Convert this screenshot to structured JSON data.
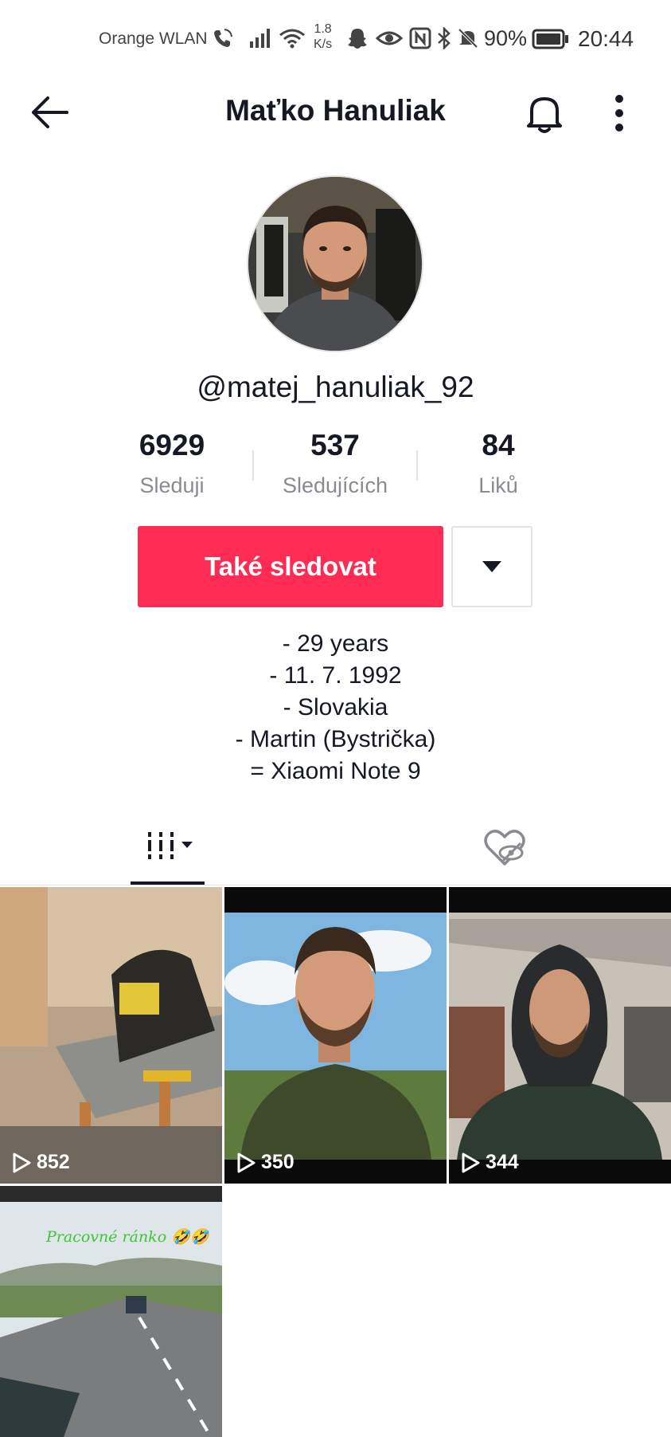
{
  "status_bar": {
    "carrier": "Orange WLAN",
    "net_speed_value": "1.8",
    "net_speed_unit": "K/s",
    "battery": "90%",
    "time": "20:44"
  },
  "header": {
    "title": "Maťko Hanuliak"
  },
  "profile": {
    "handle": "@matej_hanuliak_92",
    "stats": [
      {
        "value": "6929",
        "label": "Sleduji"
      },
      {
        "value": "537",
        "label": "Sledujících"
      },
      {
        "value": "84",
        "label": "Liků"
      }
    ],
    "follow_label": "Také sledovat",
    "bio": [
      "- 29 years",
      "- 11. 7. 1992",
      "- Slovakia",
      "- Martin (Bystrička)",
      "= Xiaomi Note 9"
    ]
  },
  "videos": [
    {
      "views": "852"
    },
    {
      "views": "350"
    },
    {
      "views": "344"
    },
    {
      "views": "",
      "caption": "Pracovné ránko 🤣🤣"
    }
  ],
  "colors": {
    "accent": "#fe2c55",
    "text": "#161823",
    "muted": "#8a8b91"
  }
}
